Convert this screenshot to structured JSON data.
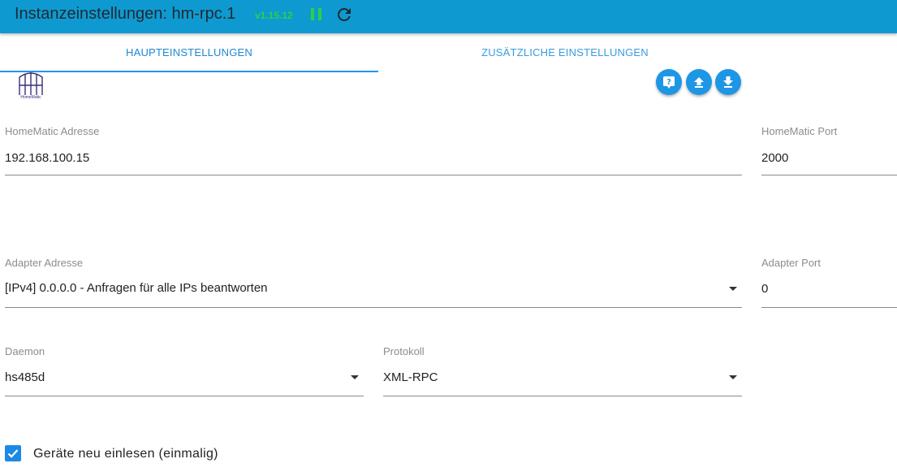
{
  "header": {
    "title": "Instanzeinstellungen: hm-rpc.1",
    "version": "v1.15.12",
    "colors": {
      "bar": "#0e9ad0",
      "version": "#2bd04a"
    }
  },
  "tabs": [
    {
      "label": "HAUPTEINSTELLUNGEN",
      "active": true
    },
    {
      "label": "ZUSÄTZLICHE EINSTELLUNGEN",
      "active": false
    }
  ],
  "logo": {
    "text": "HomeMatic"
  },
  "toolbar": {
    "icons": [
      "help-icon",
      "upload-icon",
      "download-icon"
    ]
  },
  "fields": {
    "homematic_address": {
      "label": "HomeMatic Adresse",
      "value": "192.168.100.15"
    },
    "homematic_port": {
      "label": "HomeMatic Port",
      "value": "2000"
    },
    "adapter_address": {
      "label": "Adapter Adresse",
      "value": "[IPv4] 0.0.0.0 - Anfragen für alle IPs beantworten"
    },
    "adapter_port": {
      "label": "Adapter Port",
      "value": "0"
    },
    "daemon": {
      "label": "Daemon",
      "value": "hs485d"
    },
    "protocol": {
      "label": "Protokoll",
      "value": "XML-RPC"
    }
  },
  "checkbox": {
    "label": "Geräte neu einlesen (einmalig)",
    "checked": true
  }
}
